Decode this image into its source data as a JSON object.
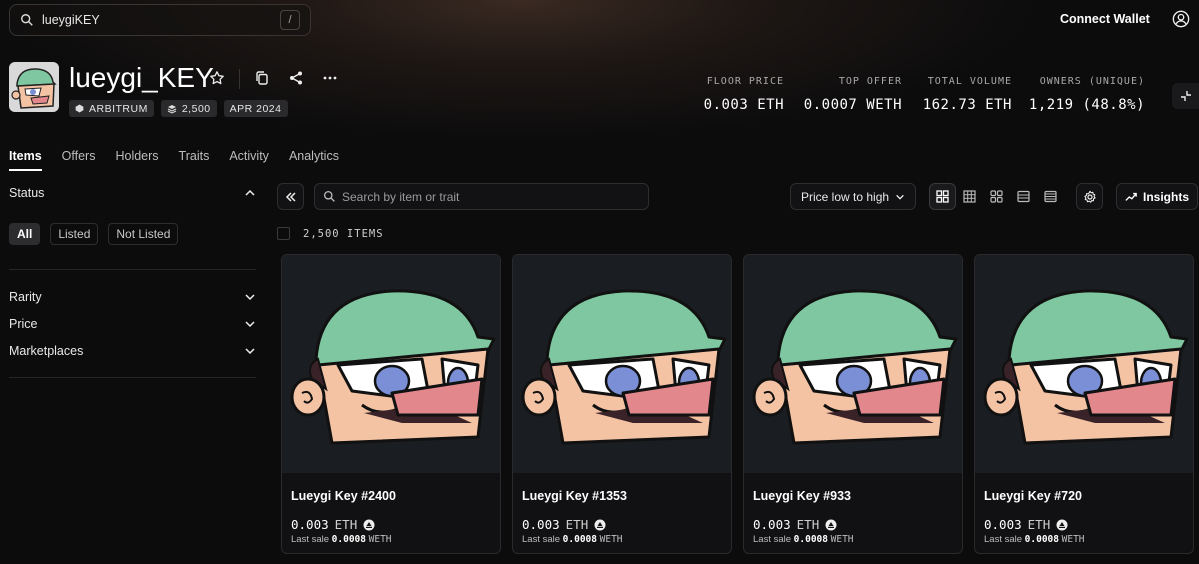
{
  "search": {
    "value": "lueygiKEY",
    "shortcut": "/"
  },
  "header": {
    "connect_label": "Connect Wallet"
  },
  "collection": {
    "name": "lueygi_KEY",
    "chips": {
      "chain": "ARBITRUM",
      "supply": "2,500",
      "date": "APR 2024"
    },
    "stats": [
      {
        "label": "FLOOR PRICE",
        "value": "0.003 ETH"
      },
      {
        "label": "TOP OFFER",
        "value": "0.0007 WETH"
      },
      {
        "label": "TOTAL VOLUME",
        "value": "162.73 ETH"
      },
      {
        "label": "OWNERS (UNIQUE)",
        "value": "1,219 (48.8%)"
      }
    ]
  },
  "tabs": [
    "Items",
    "Offers",
    "Holders",
    "Traits",
    "Activity",
    "Analytics"
  ],
  "sidebar": {
    "status_label": "Status",
    "status_filters": [
      "All",
      "Listed",
      "Not Listed"
    ],
    "sections": [
      "Rarity",
      "Price",
      "Marketplaces"
    ]
  },
  "toolbar": {
    "search_placeholder": "Search by item or trait",
    "sort_label": "Price low to high",
    "insights_label": "Insights",
    "items_count": "2,500 ITEMS"
  },
  "items": [
    {
      "name": "Lueygi Key #2400",
      "price": "0.003",
      "currency": "ETH",
      "last_sale_label": "Last sale",
      "last_sale_value": "0.0008",
      "last_sale_currency": "WETH"
    },
    {
      "name": "Lueygi Key #1353",
      "price": "0.003",
      "currency": "ETH",
      "last_sale_label": "Last sale",
      "last_sale_value": "0.0008",
      "last_sale_currency": "WETH"
    },
    {
      "name": "Lueygi Key #933",
      "price": "0.003",
      "currency": "ETH",
      "last_sale_label": "Last sale",
      "last_sale_value": "0.0008",
      "last_sale_currency": "WETH"
    },
    {
      "name": "Lueygi Key #720",
      "price": "0.003",
      "currency": "ETH",
      "last_sale_label": "Last sale",
      "last_sale_value": "0.0008",
      "last_sale_currency": "WETH"
    }
  ],
  "colors": {
    "cap": "#7fc7a0",
    "skin": "#f4c3a4",
    "eye": "#7a8fd6",
    "nose": "#e2878c",
    "mustache": "#3a2328",
    "card_bg": "#1a1d21"
  }
}
